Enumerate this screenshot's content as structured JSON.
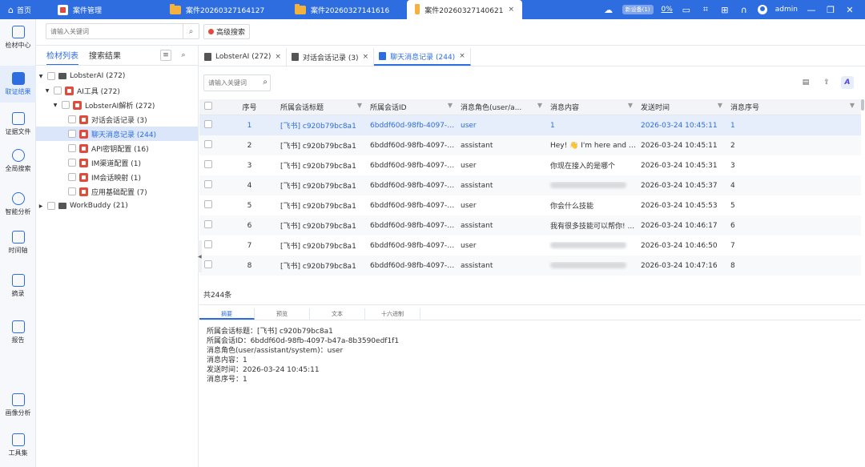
{
  "titlebar": {
    "home": "首页",
    "tabs": [
      {
        "label": "案件管理"
      },
      {
        "label": "案件20260327164127"
      },
      {
        "label": "案件20260327141616"
      },
      {
        "label": "案件20260327140621"
      }
    ],
    "close": "×",
    "pill": "新设备(1)",
    "percent": "0%",
    "user": "admin"
  },
  "rail": {
    "items": [
      {
        "label": "检材中心"
      },
      {
        "label": "取证结果"
      },
      {
        "label": "证据文件"
      },
      {
        "label": "全局搜索"
      },
      {
        "label": "智能分析"
      },
      {
        "label": "时间轴"
      },
      {
        "label": "摘录"
      },
      {
        "label": "报告"
      },
      {
        "label": "画像分析"
      },
      {
        "label": "工具集"
      }
    ]
  },
  "search": {
    "placeholder": "请输入关键词",
    "advanced": "高级搜索"
  },
  "tree": {
    "tabs": [
      "检材列表",
      "搜索结果"
    ],
    "rows": [
      {
        "label": "LobsterAI (272)"
      },
      {
        "label": "AI工具 (272)"
      },
      {
        "label": "LobsterAI解析 (272)"
      },
      {
        "label": "对话会话记录 (3)"
      },
      {
        "label": "聊天消息记录 (244)"
      },
      {
        "label": "API密钥配置 (16)"
      },
      {
        "label": "IM渠道配置 (1)"
      },
      {
        "label": "IM会话映射 (1)"
      },
      {
        "label": "应用基础配置 (7)"
      },
      {
        "label": "WorkBuddy (21)"
      }
    ]
  },
  "doc_tabs": [
    {
      "label": "LobsterAI (272)"
    },
    {
      "label": "对话会话记录 (3)"
    },
    {
      "label": "聊天消息记录 (244)"
    }
  ],
  "grid": {
    "search_placeholder": "请输入关键词",
    "columns": [
      "序号",
      "所属会话标题",
      "所属会话ID",
      "消息角色(user/a...",
      "消息内容",
      "发送时间",
      "消息序号"
    ],
    "rows": [
      {
        "idx": "1",
        "title": "[飞书] c920b79bc8a1",
        "sid": "6bddf60d-98fb-4097-b...",
        "role": "user",
        "content": "1",
        "time": "2026-03-24 10:45:11",
        "seq": "1"
      },
      {
        "idx": "2",
        "title": "[飞书] c920b79bc8a1",
        "sid": "6bddf60d-98fb-4097-b...",
        "role": "assistant",
        "content": "Hey! 👋 I'm here and r...",
        "time": "2026-03-24 10:45:11",
        "seq": "2"
      },
      {
        "idx": "3",
        "title": "[飞书] c920b79bc8a1",
        "sid": "6bddf60d-98fb-4097-b...",
        "role": "user",
        "content": "你现在接入的是哪个",
        "time": "2026-03-24 10:45:31",
        "seq": "3"
      },
      {
        "idx": "4",
        "title": "[飞书] c920b79bc8a1",
        "sid": "6bddf60d-98fb-4097-b...",
        "role": "assistant",
        "content": "",
        "time": "2026-03-24 10:45:37",
        "seq": "4"
      },
      {
        "idx": "5",
        "title": "[飞书] c920b79bc8a1",
        "sid": "6bddf60d-98fb-4097-b...",
        "role": "user",
        "content": "你会什么技能",
        "time": "2026-03-24 10:45:53",
        "seq": "5"
      },
      {
        "idx": "6",
        "title": "[飞书] c920b79bc8a1",
        "sid": "6bddf60d-98fb-4097-b...",
        "role": "assistant",
        "content": "我有很多技能可以帮你! ...",
        "time": "2026-03-24 10:46:17",
        "seq": "6"
      },
      {
        "idx": "7",
        "title": "[飞书] c920b79bc8a1",
        "sid": "6bddf60d-98fb-4097-b...",
        "role": "user",
        "content": "",
        "time": "2026-03-24 10:46:50",
        "seq": "7"
      },
      {
        "idx": "8",
        "title": "[飞书] c920b79bc8a1",
        "sid": "6bddf60d-98fb-4097-b...",
        "role": "assistant",
        "content": "",
        "time": "2026-03-24 10:47:16",
        "seq": "8"
      }
    ],
    "total": "共244条"
  },
  "detail": {
    "tabs": [
      "摘要",
      "预览",
      "文本",
      "十六进制"
    ],
    "lines": [
      "所属会话标题：[飞书] c920b79bc8a1",
      "所属会话ID：6bddf60d-98fb-4097-b47a-8b3590edf1f1",
      "消息角色(user/assistant/system)：user",
      "消息内容：1",
      "发送时间：2026-03-24 10:45:11",
      "消息序号：1"
    ]
  }
}
